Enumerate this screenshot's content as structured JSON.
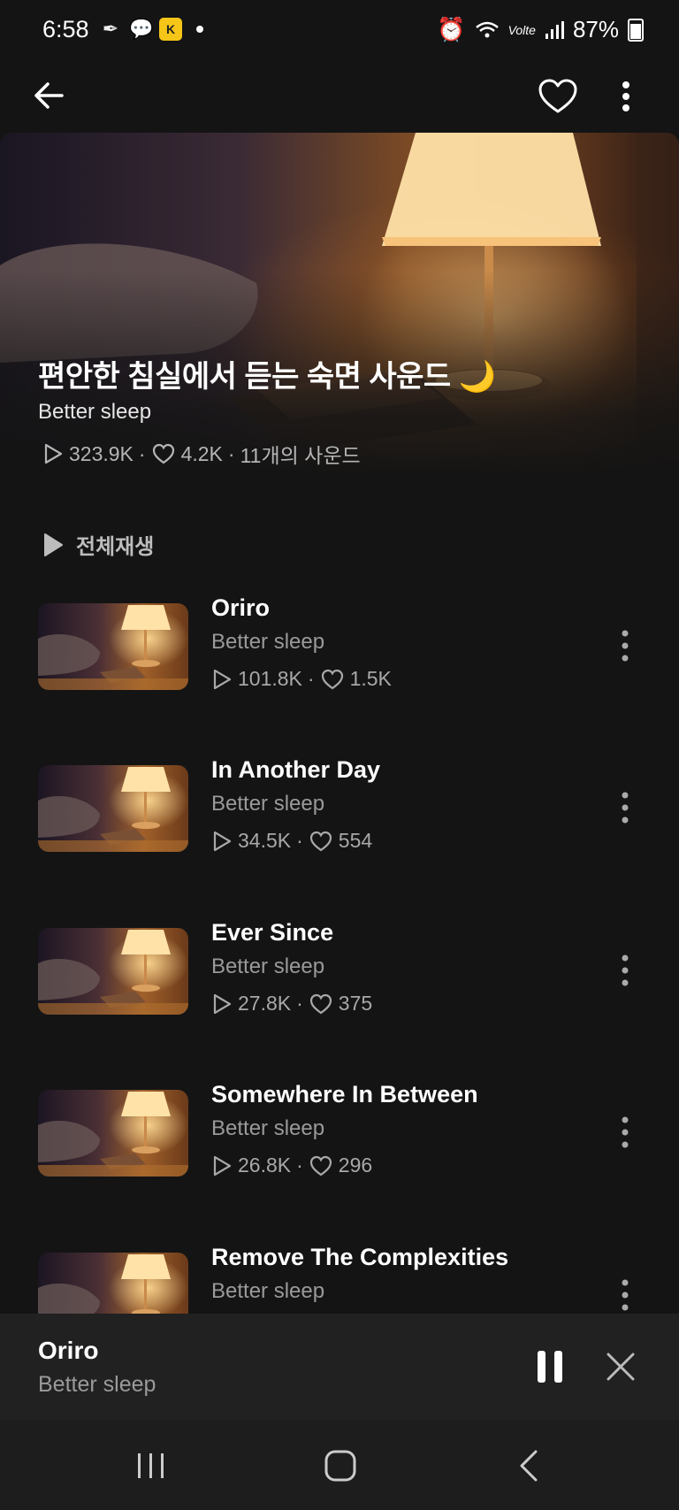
{
  "status_bar": {
    "time": "6:58",
    "battery": "87%",
    "network_label": "Volte"
  },
  "app_bar": {
    "back_icon": "arrow-left-icon",
    "favorite_icon": "heart-outline-icon",
    "more_icon": "more-vertical-icon"
  },
  "hero": {
    "title": "편안한 침실에서 듣는 숙면 사운드 🌙",
    "creator": "Better sleep",
    "plays": "323.9K",
    "likes": "4.2K",
    "sound_count": "11개의 사운드"
  },
  "play_all_label": "전체재생",
  "tracks": [
    {
      "title": "Oriro",
      "artist": "Better sleep",
      "plays": "101.8K",
      "likes": "1.5K"
    },
    {
      "title": "In Another Day",
      "artist": "Better sleep",
      "plays": "34.5K",
      "likes": "554"
    },
    {
      "title": "Ever Since",
      "artist": "Better sleep",
      "plays": "27.8K",
      "likes": "375"
    },
    {
      "title": "Somewhere In Between",
      "artist": "Better sleep",
      "plays": "26.8K",
      "likes": "296"
    },
    {
      "title": "Remove The Complexities",
      "artist": "Better sleep"
    }
  ],
  "mini_player": {
    "title": "Oriro",
    "artist": "Better sleep"
  },
  "colors": {
    "background": "#141414",
    "mini_player_bg": "#212121",
    "nav_bar_bg": "#1d1d1d",
    "secondary_text": "#9a9a9a"
  }
}
